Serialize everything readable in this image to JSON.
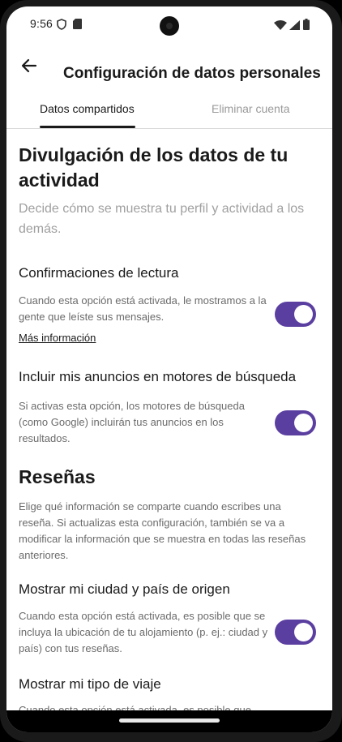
{
  "status_bar": {
    "time": "9:56"
  },
  "app_bar": {
    "title": "Configuración de datos personales"
  },
  "tabs": [
    {
      "label": "Datos compartidos",
      "active": true
    },
    {
      "label": "Eliminar cuenta",
      "active": false
    }
  ],
  "page": {
    "heading": "Divulgación de los datos de tu actividad",
    "subtitle": "Decide cómo se muestra tu perfil y actividad a los demás."
  },
  "settings": [
    {
      "title": "Confirmaciones de lectura",
      "description": "Cuando esta opción está activada, le mostramos a la gente que leíste sus mensajes.",
      "link": "Más información",
      "enabled": true
    },
    {
      "title": "Incluir mis anuncios en motores de búsqueda",
      "description": "Si activas esta opción, los motores de búsqueda (como Google) incluirán tus anuncios en los resultados.",
      "enabled": true
    }
  ],
  "reviews": {
    "heading": "Reseñas",
    "description": "Elige qué información se comparte cuando escribes una reseña. Si actualizas esta configuración, también se va a modificar la información que se muestra en todas las reseñas anteriores.",
    "items": [
      {
        "title": "Mostrar mi ciudad y país de origen",
        "description": "Cuando esta opción está activada, es posible que se incluya la ubicación de tu alojamiento (p. ej.: ciudad y país) con tus reseñas.",
        "enabled": true
      },
      {
        "title": "Mostrar mi tipo de viaje",
        "description": "Cuando esta opción está activada, es posible que"
      }
    ]
  },
  "colors": {
    "toggle_on": "#5b3fa0",
    "text_primary": "#1a1a1a",
    "text_secondary": "#6b6b6b"
  },
  "icons": [
    "shield-icon",
    "sd-card-icon",
    "wifi-icon",
    "signal-icon",
    "battery-icon",
    "back-arrow-icon"
  ]
}
